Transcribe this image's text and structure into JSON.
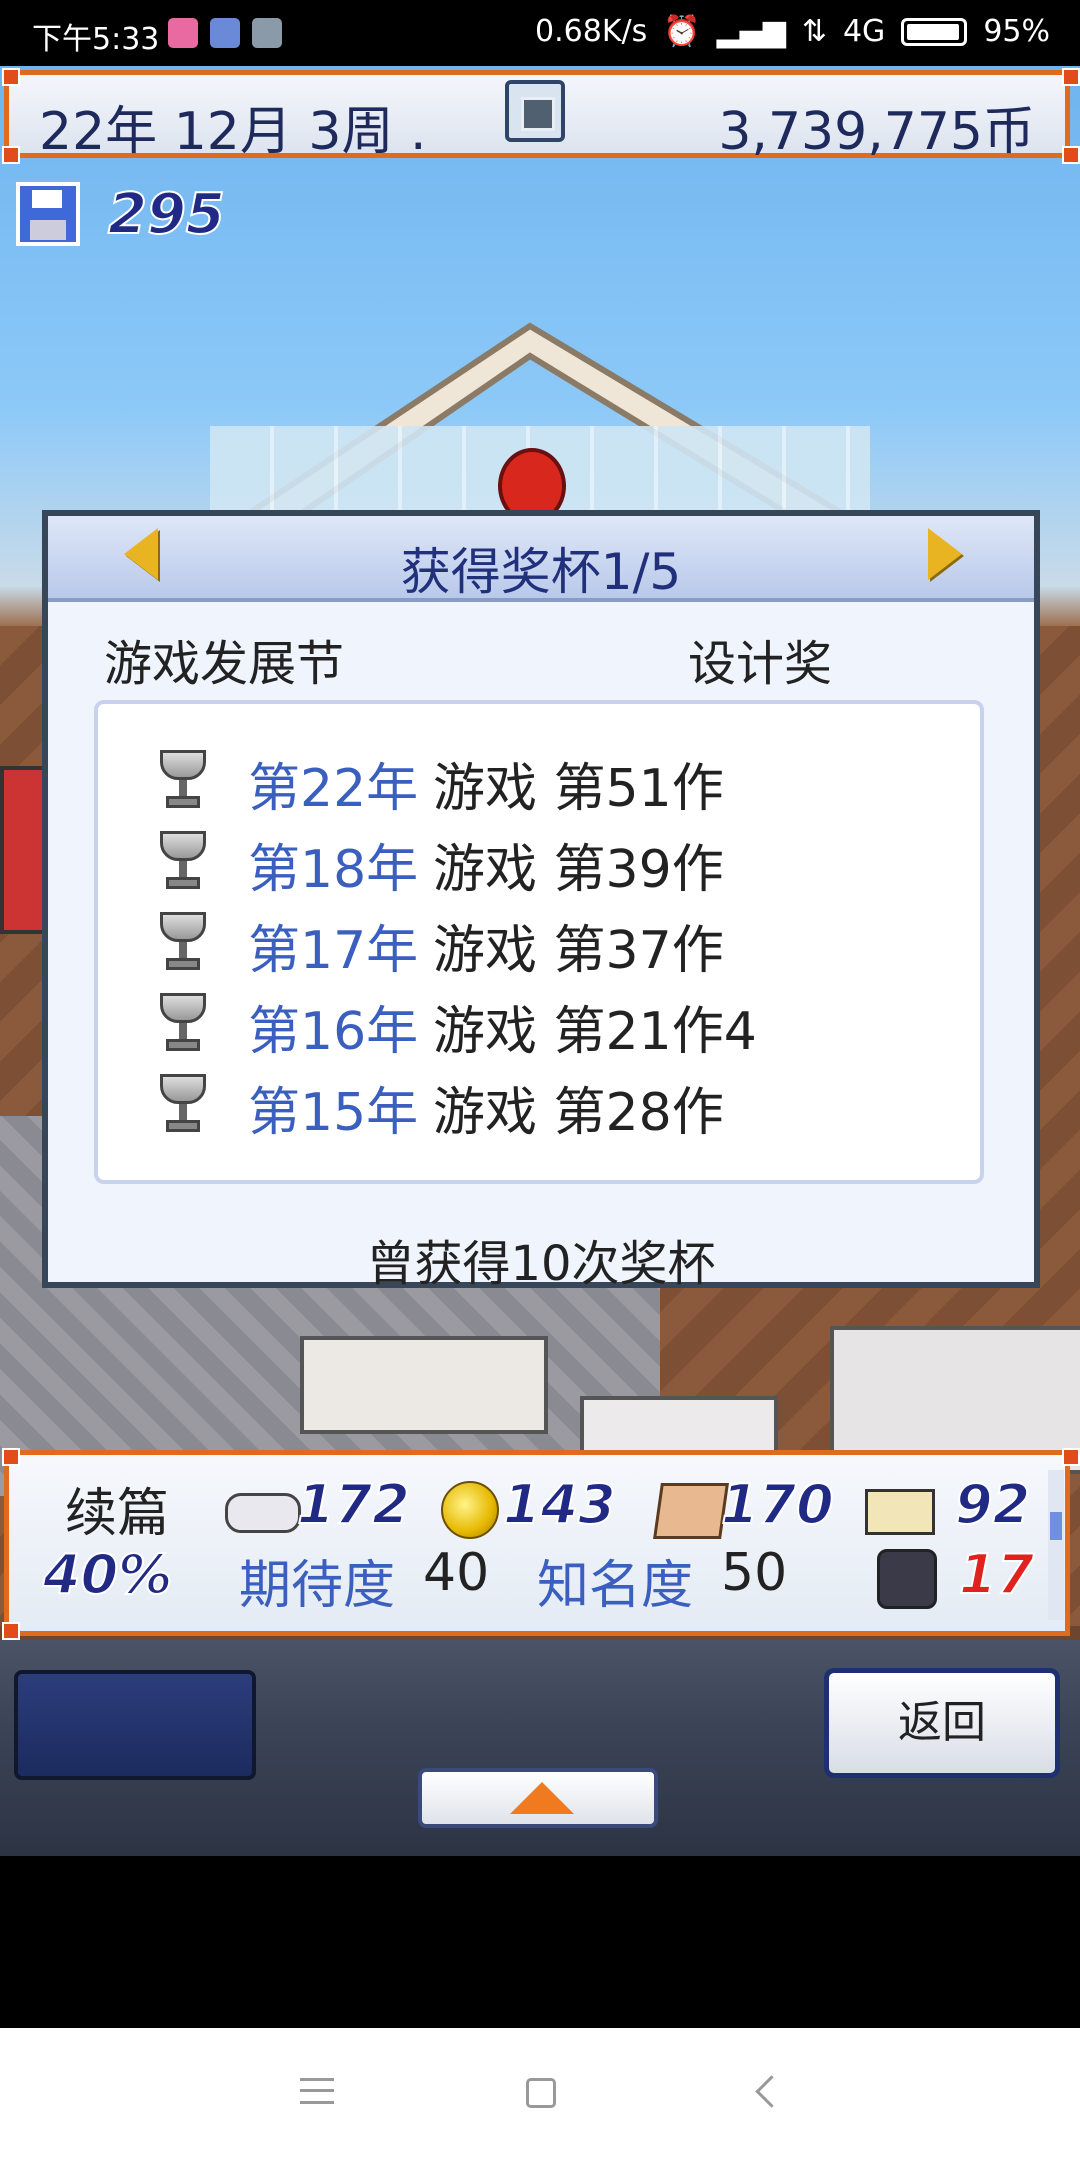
{
  "status_bar": {
    "time": "下午5:33",
    "network_speed": "0.68K/s",
    "network_type": "4G",
    "battery_percent": "95%",
    "battery_level": 0.95
  },
  "hud_top": {
    "date": "22年 12月 3周 .",
    "money": "3,739,775币",
    "save_count": "295"
  },
  "dialog": {
    "title": "获得奖杯1/5",
    "category_left": "游戏发展节",
    "category_right": "设计奖",
    "awards": [
      {
        "year": "第22年",
        "desc": "游戏 第51作"
      },
      {
        "year": "第18年",
        "desc": "游戏 第39作"
      },
      {
        "year": "第17年",
        "desc": "游戏 第37作"
      },
      {
        "year": "第16年",
        "desc": "游戏 第21作4"
      },
      {
        "year": "第15年",
        "desc": "游戏 第28作"
      }
    ],
    "total_text": "曾获得10次奖杯"
  },
  "hud_bottom": {
    "label": "续篇",
    "percent": "40%",
    "stat_fun": "172",
    "stat_creativity": "143",
    "stat_graphics": "170",
    "stat_sound": "92",
    "expectation_label": "期待度",
    "expectation_value": "40",
    "fame_label": "知名度",
    "fame_value": "50",
    "bugs": "17"
  },
  "controls": {
    "back_label": "返回"
  },
  "colors": {
    "accent_orange": "#e06b1c",
    "year_blue": "#3a5fbf",
    "dialog_title": "#21307a"
  }
}
